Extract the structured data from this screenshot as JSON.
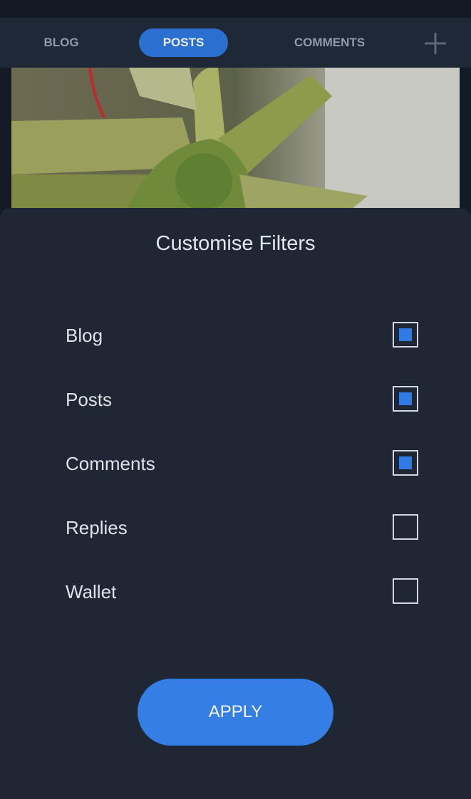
{
  "tabs": {
    "blog": "BLOG",
    "posts": "POSTS",
    "comments": "COMMENTS",
    "active": "posts",
    "add_icon": "plus-icon"
  },
  "colors": {
    "active_tab": "#2b6fd0",
    "checkbox_fill": "#2f7ae5",
    "apply_button": "#357ee6",
    "sheet_background": "#1f2734"
  },
  "sheet": {
    "title": "Customise Filters",
    "filters": [
      {
        "label": "Blog",
        "checked": true
      },
      {
        "label": "Posts",
        "checked": true
      },
      {
        "label": "Comments",
        "checked": true
      },
      {
        "label": "Replies",
        "checked": false
      },
      {
        "label": "Wallet",
        "checked": false
      }
    ],
    "apply_label": "APPLY"
  }
}
